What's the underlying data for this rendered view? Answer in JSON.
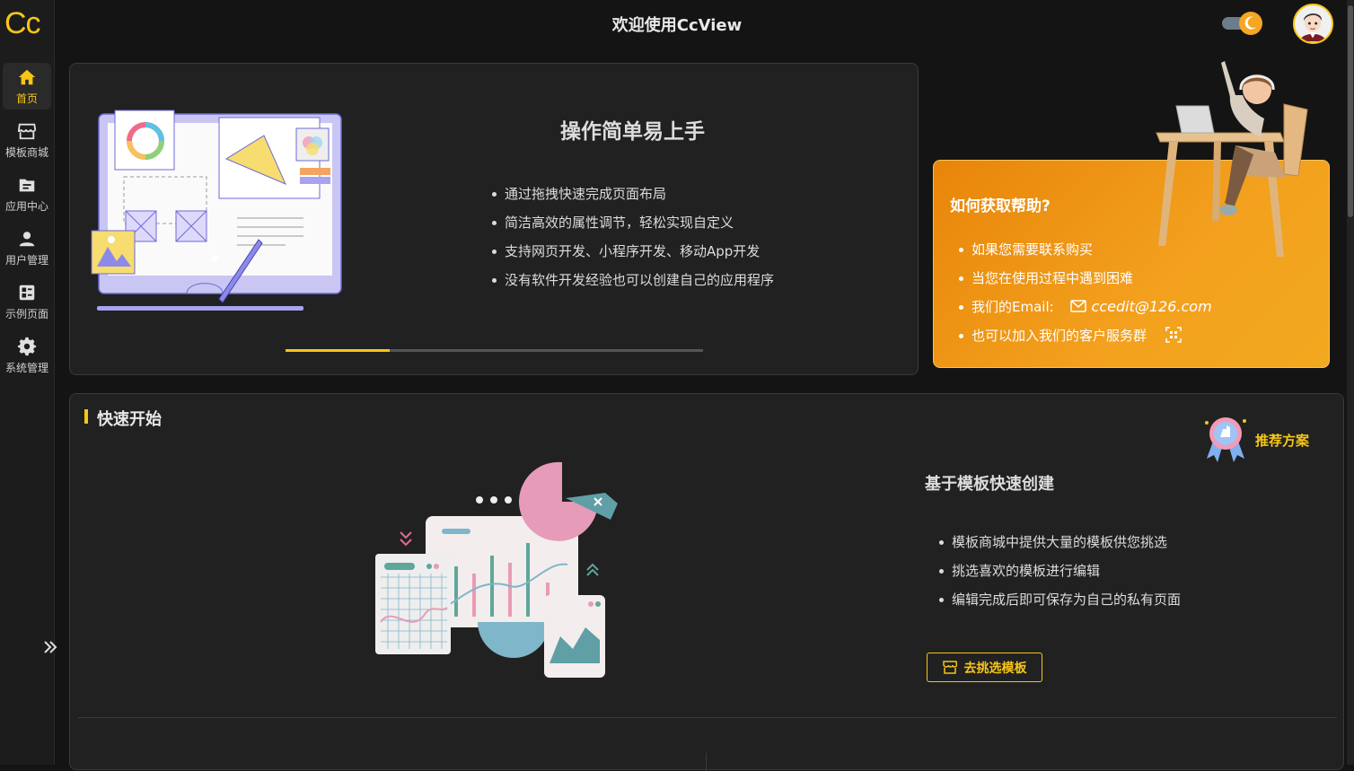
{
  "app": {
    "logo": "Cc",
    "title": "欢迎使用CcView"
  },
  "sidebar": {
    "items": [
      {
        "label": "首页",
        "icon": "home-icon",
        "active": true
      },
      {
        "label": "模板商城",
        "icon": "store-icon",
        "active": false
      },
      {
        "label": "应用中心",
        "icon": "app-folder-icon",
        "active": false
      },
      {
        "label": "用户管理",
        "icon": "user-icon",
        "active": false
      },
      {
        "label": "示例页面",
        "icon": "dashboard-icon",
        "active": false
      },
      {
        "label": "系统管理",
        "icon": "gear-icon",
        "active": false
      }
    ],
    "expand_icon": "double-chevron-right-icon"
  },
  "header": {
    "theme_toggle_icon": "moon-toggle-icon",
    "avatar_icon": "avatar-icon"
  },
  "intro": {
    "heading": "操作简单易上手",
    "bullets": [
      "通过拖拽快速完成页面布局",
      "简洁高效的属性调节，轻松实现自定义",
      "支持网页开发、小程序开发、移动App开发",
      "没有软件开发经验也可以创建自己的应用程序"
    ],
    "carousel_progress": 0.25
  },
  "help": {
    "heading": "如何获取帮助?",
    "bullets": [
      "如果您需要联系购买",
      "当您在使用过程中遇到困难",
      "我们的Email:",
      "也可以加入我们的客户服务群"
    ],
    "email": "ccedit@126.com"
  },
  "quick_start": {
    "title": "快速开始",
    "recommend_label": "推荐方案",
    "heading": "基于模板快速创建",
    "bullets": [
      "模板商城中提供大量的模板供您挑选",
      "挑选喜欢的模板进行编辑",
      "编辑完成后即可保存为自己的私有页面"
    ],
    "button_label": "去挑选模板"
  },
  "colors": {
    "accent": "#f5c518",
    "help_bg": "#f3a11e",
    "background": "#141414",
    "card": "#212121"
  }
}
